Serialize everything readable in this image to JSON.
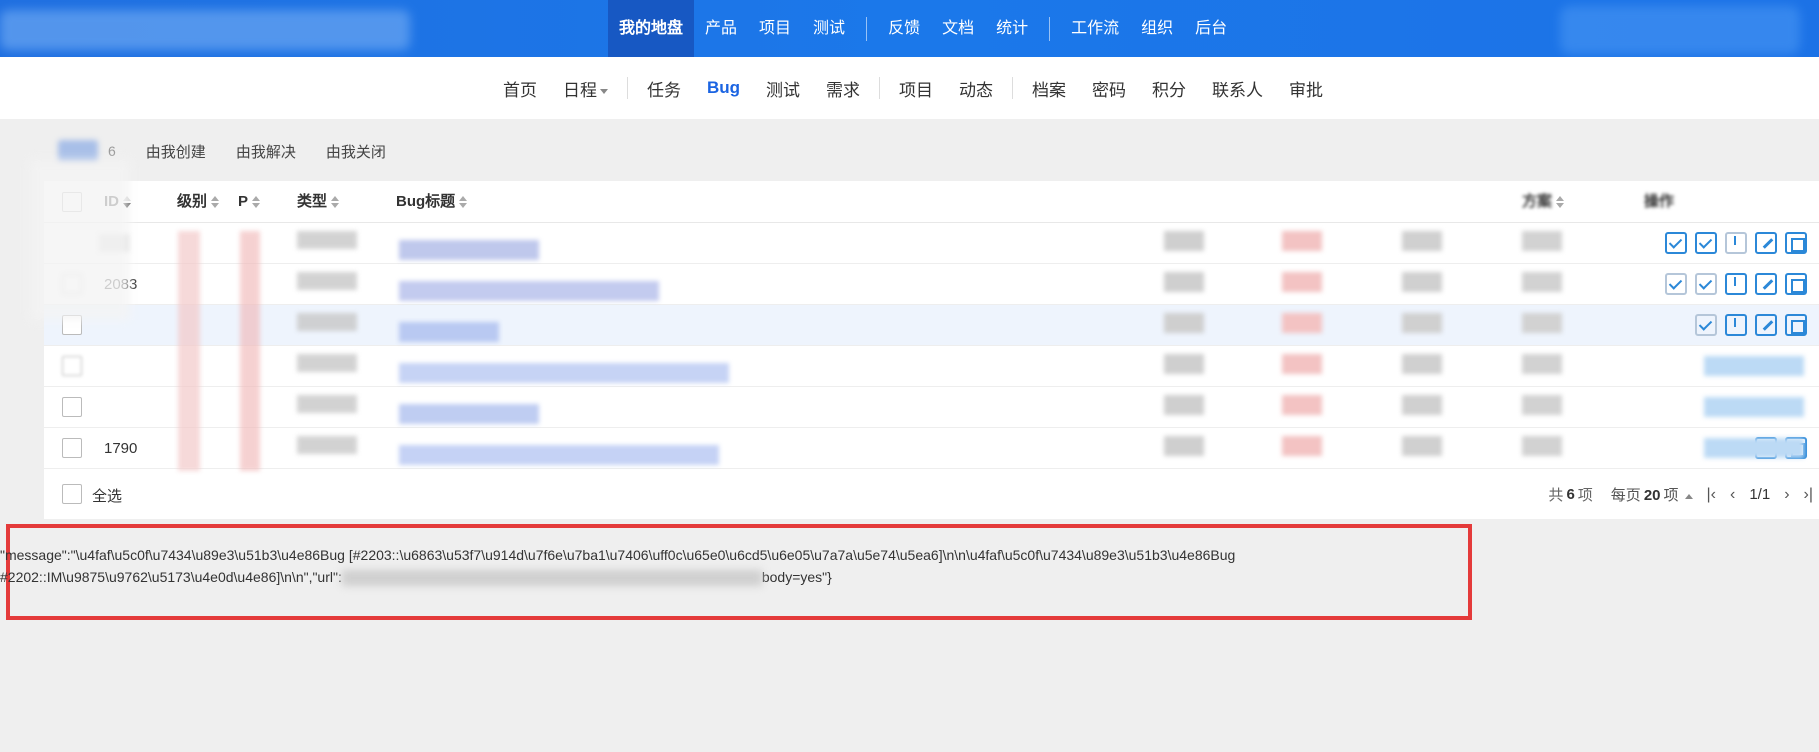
{
  "top_nav": {
    "items": [
      {
        "label": "我的地盘",
        "active": true
      },
      {
        "label": "产品"
      },
      {
        "label": "项目"
      },
      {
        "label": "测试"
      },
      {
        "label": "反馈"
      },
      {
        "label": "文档"
      },
      {
        "label": "统计"
      },
      {
        "label": "工作流"
      },
      {
        "label": "组织"
      },
      {
        "label": "后台"
      }
    ]
  },
  "sub_nav": {
    "items": [
      {
        "label": "首页"
      },
      {
        "label": "日程"
      },
      {
        "label": "任务"
      },
      {
        "label": "Bug",
        "active": true
      },
      {
        "label": "测试"
      },
      {
        "label": "需求"
      },
      {
        "label": "项目"
      },
      {
        "label": "动态"
      },
      {
        "label": "档案"
      },
      {
        "label": "密码"
      },
      {
        "label": "积分"
      },
      {
        "label": "联系人"
      },
      {
        "label": "审批"
      }
    ]
  },
  "filters": {
    "active_count": "6",
    "items": [
      "由我创建",
      "由我解决",
      "由我关闭"
    ]
  },
  "table": {
    "headers": {
      "id": "ID",
      "severity": "级别",
      "priority": "P",
      "type": "类型",
      "title": "Bug标题",
      "solution": "方案",
      "actions": "操作"
    },
    "rows": [
      {
        "id": ""
      },
      {
        "id": "2083"
      },
      {
        "id": ""
      },
      {
        "id": ""
      },
      {
        "id": ""
      },
      {
        "id": "1790"
      }
    ]
  },
  "footer": {
    "select_all": "全选",
    "total_prefix": "共",
    "total": "6",
    "total_suffix": "项",
    "per_page_prefix": "每页",
    "per_page": "20",
    "per_page_suffix": "项",
    "page": "1/1"
  },
  "error": {
    "line1": "\"message\":\"\\u4faf\\u5c0f\\u7434\\u89e3\\u51b3\\u4e86Bug [#2203::\\u6863\\u53f7\\u914d\\u7f6e\\u7ba1\\u7406\\uff0c\\u65e0\\u6cd5\\u6e05\\u7a7a\\u5e74\\u5ea6]\\n\\n\\u4faf\\u5c0f\\u7434\\u89e3\\u51b3\\u4e86Bug",
    "line2_a": "#2202::IM\\u9875\\u9762\\u5173\\u4e0d\\u4e86]\\n\\n\",\"url\":",
    "line2_b": "body=yes\"}"
  },
  "colors": {
    "topbar": "#1b78ea",
    "accent": "#1b64e2",
    "action_icon": "#2b88d8",
    "error_border": "#e43a3a"
  }
}
